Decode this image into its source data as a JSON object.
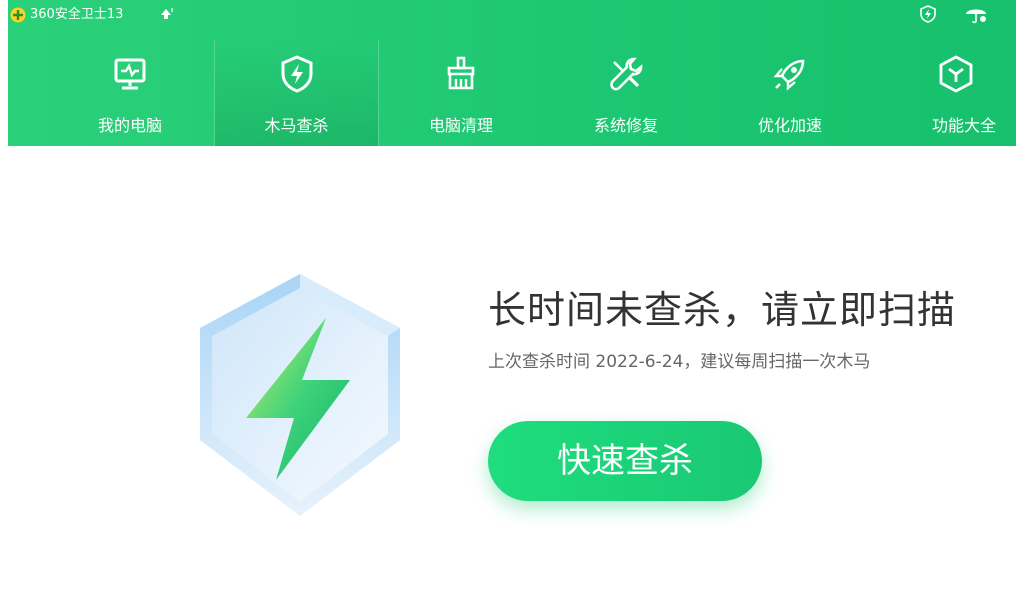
{
  "app": {
    "title": "360安全卫士13",
    "logo_icon": "360-logo-icon",
    "upgrade_icon": "upgrade-arrow-icon"
  },
  "titlebar": {
    "icons": [
      "shield-badge-icon",
      "umbrella-icon"
    ]
  },
  "nav": {
    "items": [
      {
        "label": "我的电脑",
        "icon": "monitor-icon"
      },
      {
        "label": "木马查杀",
        "icon": "shield-lightning-icon",
        "active": true
      },
      {
        "label": "电脑清理",
        "icon": "broom-icon"
      },
      {
        "label": "系统修复",
        "icon": "wrench-icon"
      },
      {
        "label": "优化加速",
        "icon": "rocket-icon"
      },
      {
        "label": "功能大全",
        "icon": "cube-icon"
      }
    ]
  },
  "main": {
    "headline": "长时间未查杀，请立即扫描",
    "subline": "上次查杀时间 2022-6-24，建议每周扫描一次木马",
    "scan_button": "快速查杀"
  },
  "colors": {
    "header_green": "#1fc873",
    "button_green": "#1fdd7e",
    "text_dark": "#333333",
    "text_gray": "#666666"
  }
}
